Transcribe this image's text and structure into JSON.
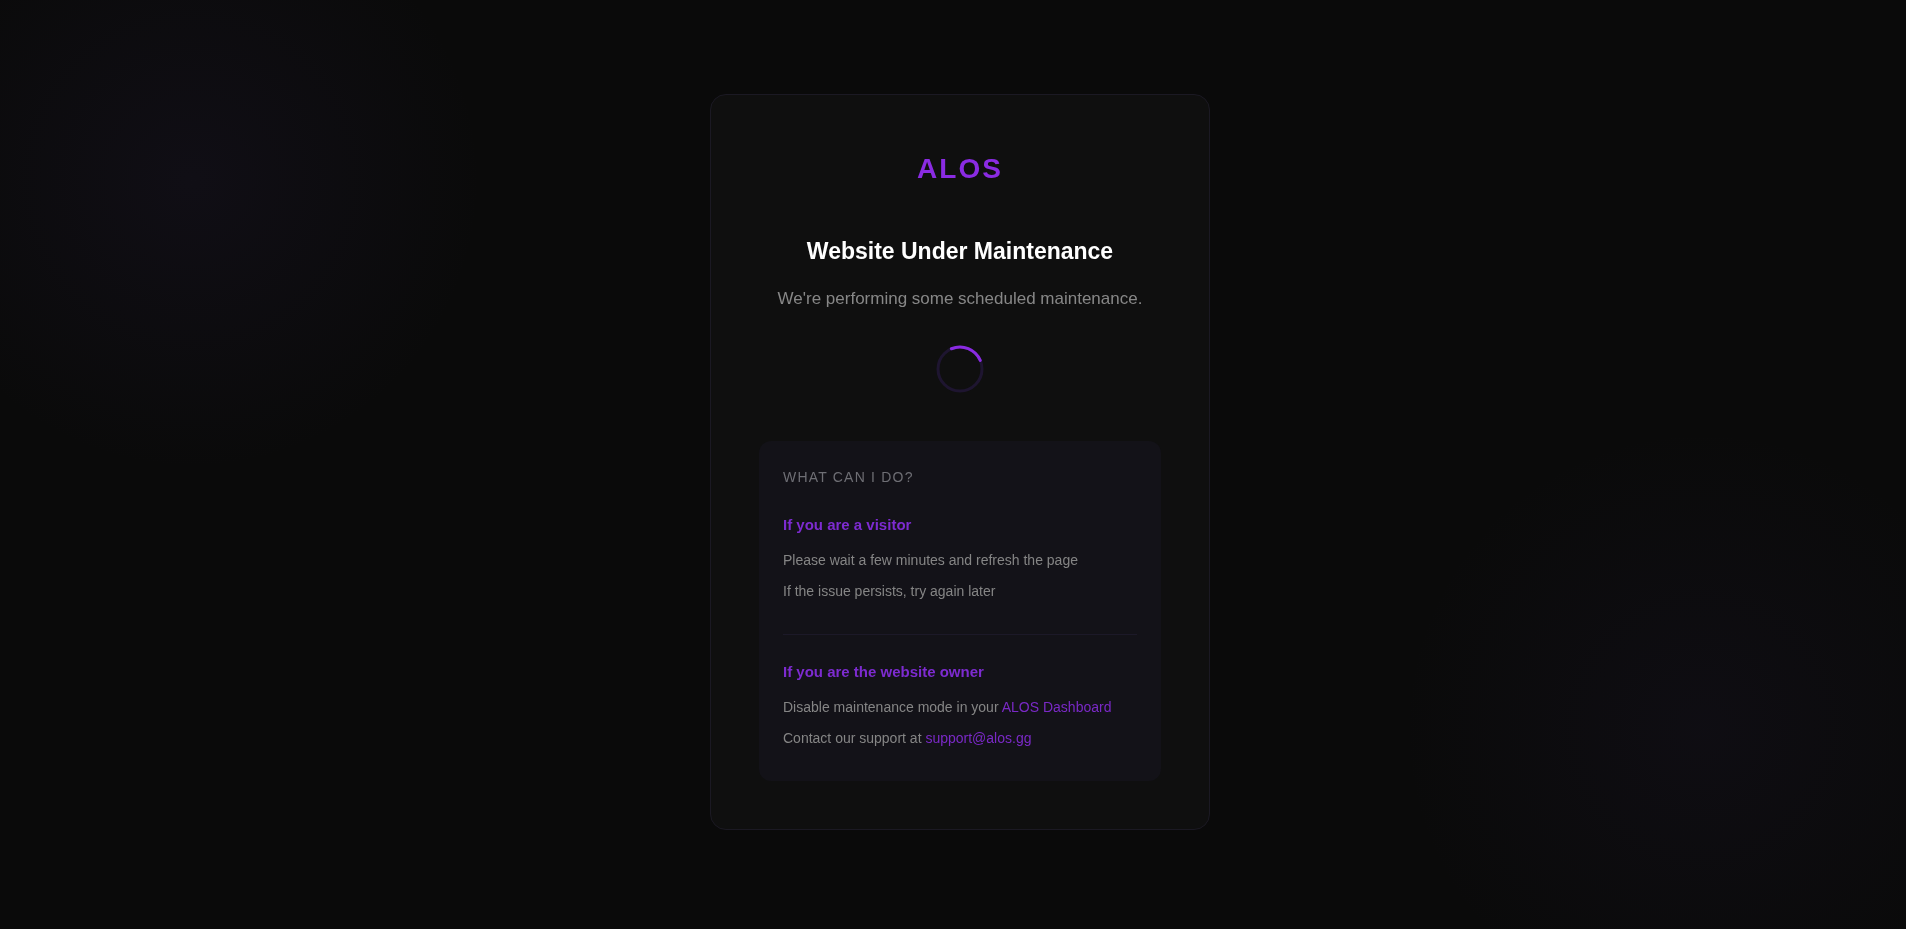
{
  "logo": {
    "text": "ALOS"
  },
  "heading": "Website Under Maintenance",
  "subtitle": "We're performing some scheduled maintenance.",
  "help": {
    "title": "WHAT CAN I DO?",
    "sections": [
      {
        "heading": "If you are a visitor",
        "lines": [
          {
            "text": "Please wait a few minutes and refresh the page"
          },
          {
            "text": "If the issue persists, try again later"
          }
        ]
      },
      {
        "heading": "If you are the website owner",
        "lines": [
          {
            "text": "Disable maintenance mode in your",
            "link": "ALOS Dashboard"
          },
          {
            "text": "Contact our support at",
            "link": "support@alos.gg"
          }
        ]
      }
    ]
  }
}
